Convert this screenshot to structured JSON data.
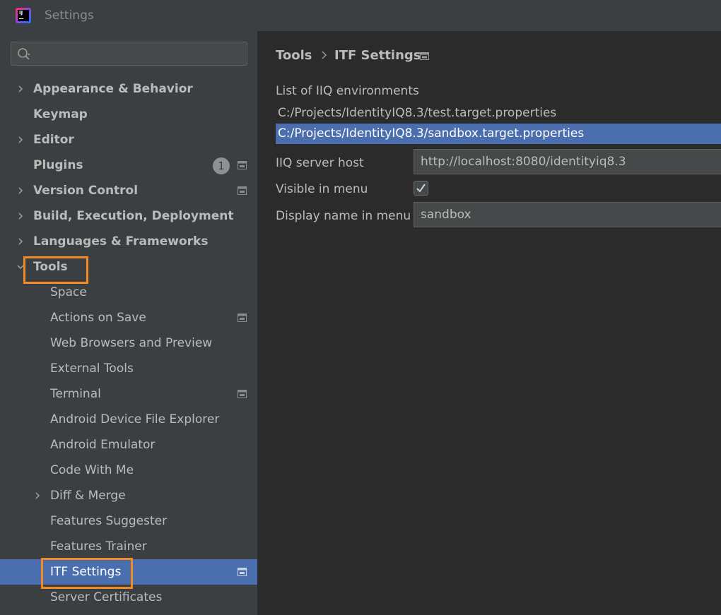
{
  "window": {
    "title": "Settings"
  },
  "search": {
    "placeholder": ""
  },
  "sidebar": {
    "items": [
      {
        "label": "Appearance & Behavior",
        "level": 0,
        "expandable": true,
        "expanded": false
      },
      {
        "label": "Keymap",
        "level": 0,
        "expandable": false
      },
      {
        "label": "Editor",
        "level": 0,
        "expandable": true,
        "expanded": false
      },
      {
        "label": "Plugins",
        "level": 0,
        "expandable": false,
        "badge": "1",
        "settings_icon": true
      },
      {
        "label": "Version Control",
        "level": 0,
        "expandable": true,
        "expanded": false,
        "settings_icon": true
      },
      {
        "label": "Build, Execution, Deployment",
        "level": 0,
        "expandable": true,
        "expanded": false
      },
      {
        "label": "Languages & Frameworks",
        "level": 0,
        "expandable": true,
        "expanded": false
      },
      {
        "label": "Tools",
        "level": 0,
        "expandable": true,
        "expanded": true
      },
      {
        "label": "Space",
        "level": 1
      },
      {
        "label": "Actions on Save",
        "level": 1,
        "settings_icon": true
      },
      {
        "label": "Web Browsers and Preview",
        "level": 1
      },
      {
        "label": "External Tools",
        "level": 1
      },
      {
        "label": "Terminal",
        "level": 1,
        "settings_icon": true
      },
      {
        "label": "Android Device File Explorer",
        "level": 1
      },
      {
        "label": "Android Emulator",
        "level": 1
      },
      {
        "label": "Code With Me",
        "level": 1
      },
      {
        "label": "Diff & Merge",
        "level": 1,
        "expandable": true,
        "expanded": false
      },
      {
        "label": "Features Suggester",
        "level": 1
      },
      {
        "label": "Features Trainer",
        "level": 1
      },
      {
        "label": "ITF Settings",
        "level": 1,
        "selected": true,
        "settings_icon": true
      },
      {
        "label": "Server Certificates",
        "level": 1
      }
    ]
  },
  "breadcrumb": {
    "parent": "Tools",
    "current": "ITF Settings"
  },
  "form": {
    "env_list_label": "List of IIQ environments",
    "environments": [
      {
        "path": "C:/Projects/IdentityIQ8.3/test.target.properties",
        "selected": false
      },
      {
        "path": "C:/Projects/IdentityIQ8.3/sandbox.target.properties",
        "selected": true
      }
    ],
    "server_host_label": "IIQ server host",
    "server_host_value": "http://localhost:8080/identityiq8.3",
    "visible_label": "Visible in menu",
    "visible_checked": true,
    "display_name_label": "Display name in menu",
    "display_name_value": "sandbox"
  },
  "colors": {
    "selection": "#4b6eaf",
    "highlight_box": "#f28a26",
    "sidebar_bg": "#3c3f41",
    "main_bg": "#2b2b2b",
    "text": "#bbbbbb"
  }
}
